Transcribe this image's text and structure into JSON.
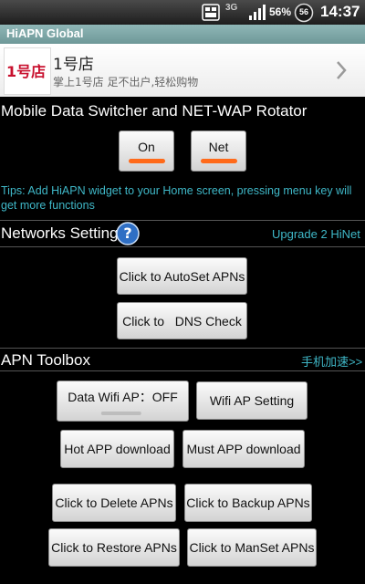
{
  "status_bar": {
    "network_type": "3G",
    "battery": "56%",
    "badge": "56",
    "time": "14:37"
  },
  "title_bar": {
    "title": "HiAPN Global"
  },
  "ad_banner": {
    "logo_text": "1号店",
    "name": "1号店",
    "description": "掌上1号店 足不出户,轻松购物"
  },
  "switcher": {
    "heading": "Mobile Data Switcher and NET-WAP Rotator",
    "on_label": "On",
    "net_label": "Net",
    "indicator_color": "#ff6a1a",
    "tips": "Tips: Add HiAPN widget to your Home screen, pressing menu key will get more functions"
  },
  "networks": {
    "heading": "Networks Setting",
    "help_glyph": "?",
    "upgrade_link": "Upgrade 2 HiNet",
    "autoset_label": "Click to AutoSet APNs",
    "dns_label": "Click to   DNS Check"
  },
  "toolbox": {
    "heading": "APN Toolbox",
    "accelerate_link": "手机加速>>",
    "data_wifi_label": "Data Wifi AP：OFF",
    "wifi_setting_label": "Wifi AP Setting",
    "hot_app_label": "Hot APP download",
    "must_app_label": "Must APP download",
    "delete_label": "Click to Delete APNs",
    "backup_label": "Click to Backup APNs",
    "restore_label": "Click to Restore APNs",
    "manset_label": "Click to ManSet APNs"
  },
  "colors": {
    "accent_cyan": "#3fb8c8",
    "title_bar": "#7fa8a8",
    "help_blue": "#2f6fc4"
  }
}
